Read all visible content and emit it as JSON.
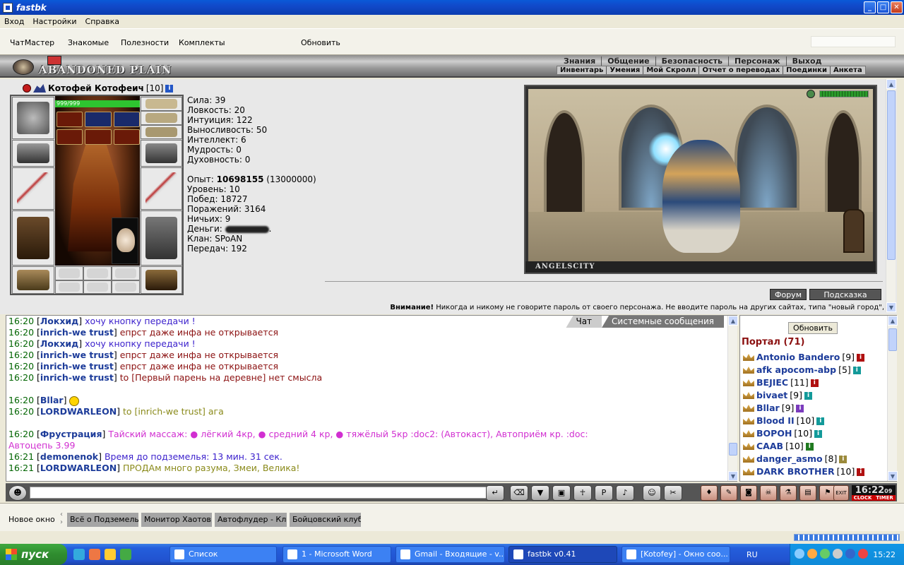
{
  "window": {
    "title": "fastbk"
  },
  "menu": [
    "Вход",
    "Настройки",
    "Справка"
  ],
  "toolbar": {
    "items": [
      "ЧатМастер",
      "Знакомые",
      "Полезности",
      "Комплекты"
    ],
    "refresh": "Обновить"
  },
  "game": {
    "logo": "ABANDONED PLAIN",
    "nav": [
      "Знания",
      "Общение",
      "Безопасность",
      "Персонаж",
      "Выход"
    ],
    "subnav": [
      "Инвентарь",
      "Умения",
      "Мой Скролл",
      "Отчет о переводах",
      "Поединки",
      "Анкета"
    ]
  },
  "character": {
    "name": "Котофей Котофеич",
    "level": "[10]",
    "hp": "999/999",
    "hp_fraction": 1.0,
    "stats": [
      {
        "label": "Сила:",
        "value": "39"
      },
      {
        "label": "Ловкость:",
        "value": "20"
      },
      {
        "label": "Интуиция:",
        "value": "122"
      },
      {
        "label": "Выносливость:",
        "value": "50"
      },
      {
        "label": "Интеллект:",
        "value": "6"
      },
      {
        "label": "Мудрость:",
        "value": "0"
      },
      {
        "label": "Духовность:",
        "value": "0"
      }
    ],
    "exp_label": "Опыт:",
    "exp": "10698155",
    "exp_next": "(13000000)",
    "info": [
      {
        "label": "Уровень:",
        "value": "10"
      },
      {
        "label": "Побед:",
        "value": "18727"
      },
      {
        "label": "Поражений:",
        "value": "3164"
      },
      {
        "label": "Ничьих:",
        "value": "9"
      },
      {
        "label": "Деньги:",
        "value": "."
      },
      {
        "label": "Клан:",
        "value": "SPoAN"
      },
      {
        "label": "Передач:",
        "value": "192"
      }
    ]
  },
  "scene": {
    "title": "ANGELSCITY",
    "hp_fraction": 1.0
  },
  "buttons": {
    "forum": "Форум",
    "hint": "Подсказка"
  },
  "warning": {
    "bold": "Внимание!",
    "text": " Никогда и никому не говорите пароль от своего персонажа. Не вводите пароль на других сайтах, типа \"новый город\","
  },
  "chat_tabs": [
    "Чат",
    "Системные сообщения"
  ],
  "chat": [
    {
      "time": "16:20",
      "nick": "Локхид",
      "text": "хочу кнопку передачи !",
      "style": "m2"
    },
    {
      "time": "16:20",
      "nick": "inrich-we trust",
      "text": "епрст даже инфа не открывается",
      "style": "m1"
    },
    {
      "time": "16:20",
      "nick": "Локхид",
      "text": "хочу кнопку передачи !",
      "style": "m2"
    },
    {
      "time": "16:20",
      "nick": "inrich-we trust",
      "text": "епрст даже инфа не открывается",
      "style": "m1"
    },
    {
      "time": "16:20",
      "nick": "inrich-we trust",
      "text": "епрст даже инфа не открывается",
      "style": "m1"
    },
    {
      "time": "16:20",
      "nick": "inrich-we trust",
      "text": "to [Первый парень на деревне] нет смысла",
      "style": "m3"
    },
    {
      "time": "16:20",
      "nick": "Bllar",
      "text": "",
      "style": "m2",
      "tall": true,
      "smiley": true
    },
    {
      "time": "16:20",
      "nick": "LORDWARLEON",
      "text": "to [inrich-we trust] ага",
      "style": "m4"
    },
    {
      "time": "16:20",
      "nick": "Фрустрация",
      "text": "Тайский массаж: ● лёгкий 4кр, ● средний 4 кр, ● тяжёлый 5кр :doc2: (Автокаст), Автоприём кр. :doc:",
      "style": "m5",
      "tall": true
    },
    {
      "time": "",
      "nick": "",
      "text": "Автоцепь 3.99",
      "style": "m5"
    },
    {
      "time": "16:21",
      "nick": "demonenok",
      "text": "Время до подземелья: 13 мин. 31 сек.",
      "style": "m6"
    },
    {
      "time": "16:21",
      "nick": "LORDWARLEON",
      "text": "ПРОДАм много разума, Змеи, Велика!",
      "style": "m7"
    }
  ],
  "users": {
    "refresh": "Обновить",
    "title": "Портал (71)",
    "list": [
      {
        "name": "Antonio Bandero",
        "level": "[9]",
        "badge": "red"
      },
      {
        "name": "afk apocom-abp",
        "level": "[5]",
        "badge": "teal"
      },
      {
        "name": "ВЕЈІЕС",
        "level": "[11]",
        "badge": "red"
      },
      {
        "name": "bivaet",
        "level": "[9]",
        "badge": "teal"
      },
      {
        "name": "Bllar",
        "level": "[9]",
        "badge": "purple"
      },
      {
        "name": "Blood II",
        "level": "[10]",
        "badge": "teal"
      },
      {
        "name": "ВОРОН",
        "level": "[10]",
        "badge": "teal"
      },
      {
        "name": "CAAB",
        "level": "[10]",
        "badge": "green"
      },
      {
        "name": "danger_asmo",
        "level": "[8]",
        "badge": "olive"
      },
      {
        "name": "DARK BROTHER",
        "level": "[10]",
        "badge": "red"
      }
    ]
  },
  "clock": {
    "time": "16:22",
    "sec": "09",
    "label1": "CLOCK",
    "label2": "TIMER"
  },
  "apptabs": {
    "new": "Новое окно",
    "tabs": [
      "Всё о Подземельях",
      "Монитор Хаотов",
      "Автофлудер - Клан",
      "Бойцовский клуб"
    ]
  },
  "taskbar": {
    "start": "пуск",
    "items": [
      "Список",
      "1 - Microsoft Word",
      "Gmail - Входящие - v...",
      "fastbk v0.41",
      "[Kotofey] - Окно соо..."
    ],
    "lang": "RU",
    "time": "15:22"
  }
}
